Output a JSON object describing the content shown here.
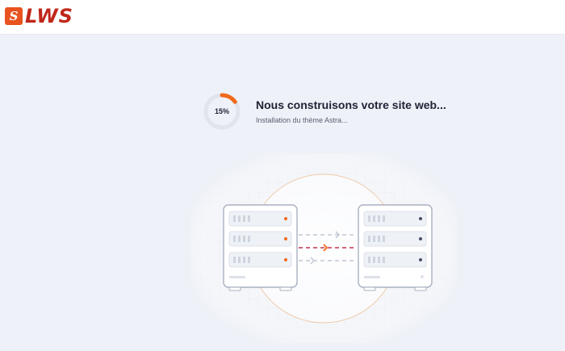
{
  "header": {
    "logo_text": "LWS",
    "logo_mark": "S"
  },
  "status": {
    "progress_percent": 15,
    "progress_label": "15%",
    "title": "Nous construisons votre site web...",
    "subtitle": "Installation du thème Astra..."
  },
  "illustration": {
    "icons": [
      "server-icon",
      "server-icon",
      "transfer-arrows-icon"
    ],
    "accent_color": "#f06a1b",
    "transfer_color": "#c2334a",
    "neutral_color": "#c3c8d4"
  },
  "colors": {
    "background": "#eef1f7",
    "progress_track": "#e1e4ec",
    "progress_fill": "#f06a1b",
    "brand": "#c0271a"
  }
}
